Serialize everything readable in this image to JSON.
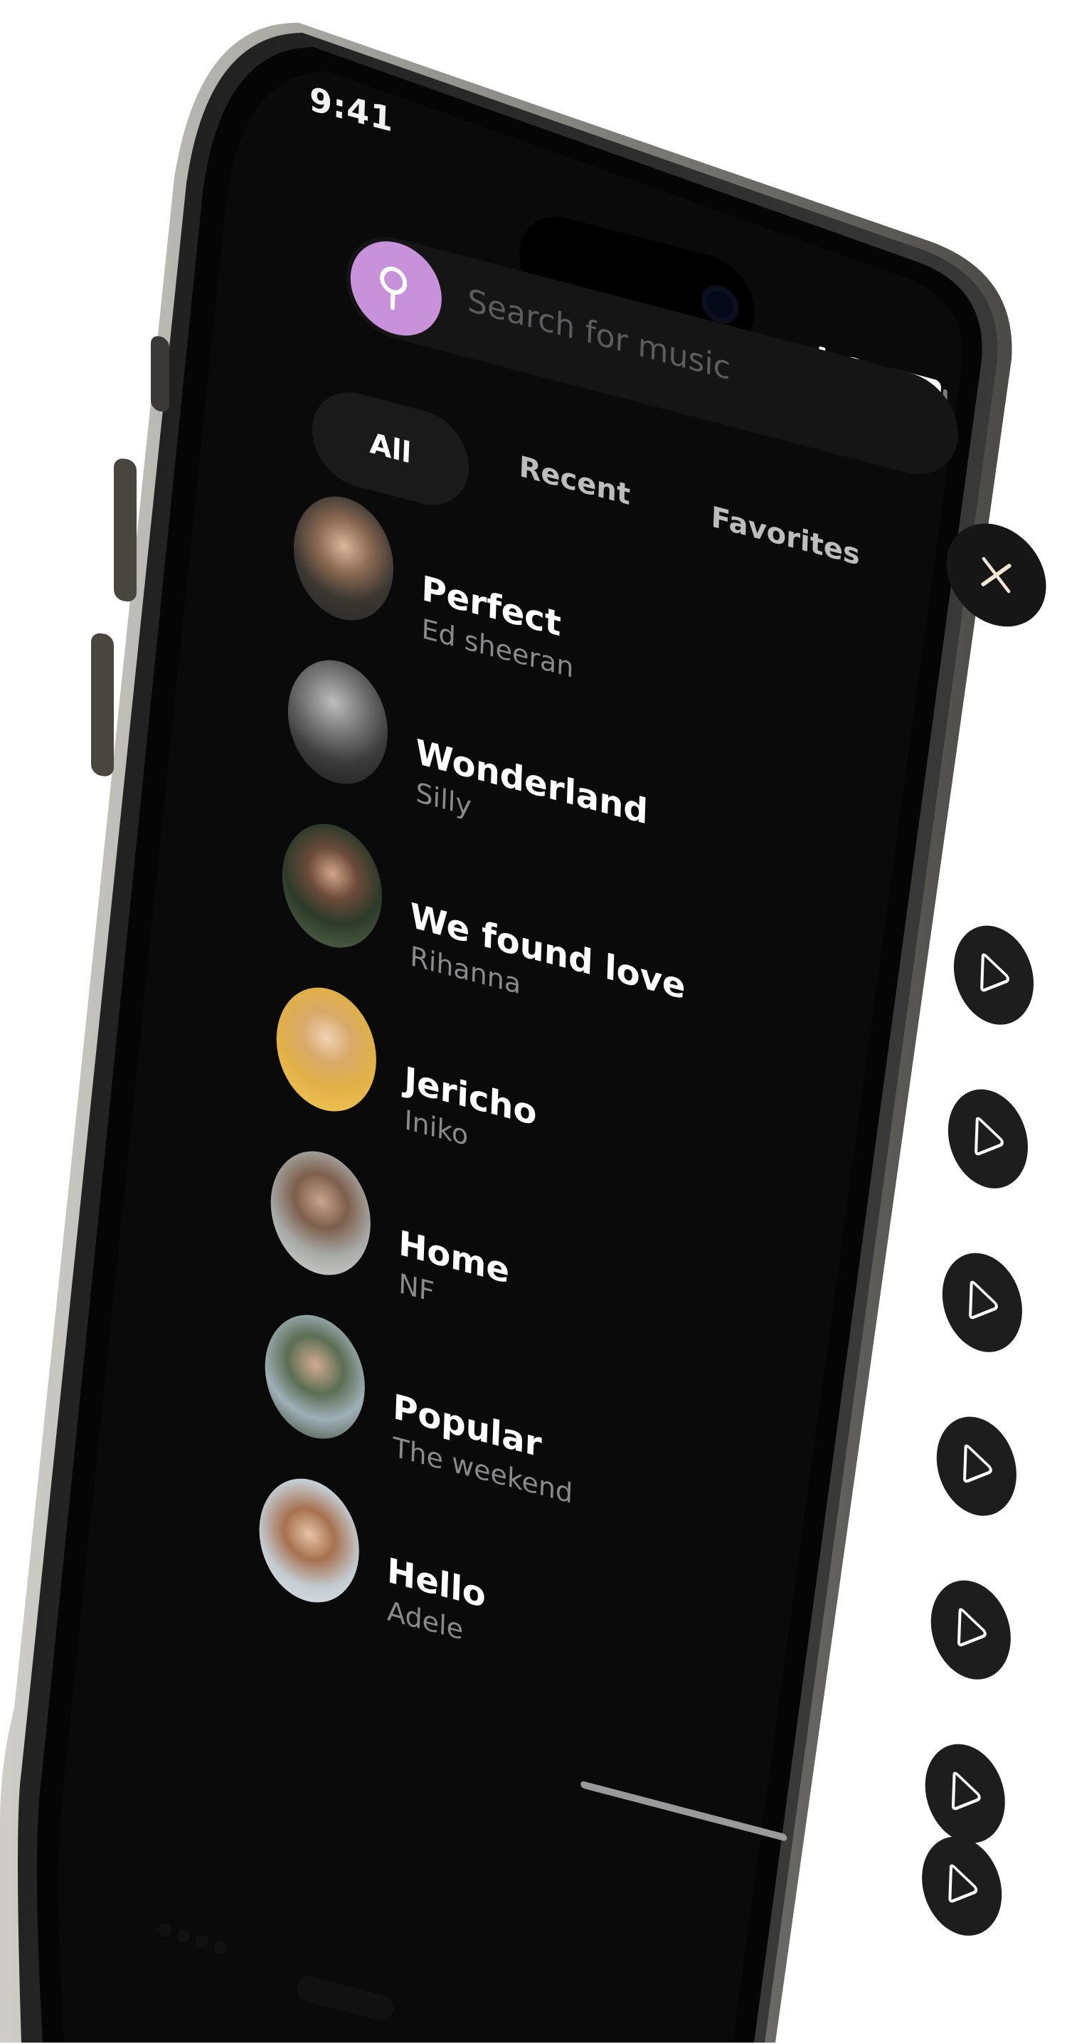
{
  "status_bar": {
    "time": "9:41"
  },
  "search": {
    "placeholder": "Search for music",
    "icon": "search-icon",
    "accent": "#c792d9"
  },
  "close_icon": "close-icon",
  "tabs": [
    {
      "label": "All",
      "selected": true
    },
    {
      "label": "Recent",
      "selected": false
    },
    {
      "label": "Favorites",
      "selected": false
    }
  ],
  "songs": [
    {
      "title": "Perfect",
      "artist": "Ed sheeran"
    },
    {
      "title": "Wonderland",
      "artist": "Silly"
    },
    {
      "title": "We found love",
      "artist": "Rihanna"
    },
    {
      "title": "Jericho",
      "artist": "Iniko"
    },
    {
      "title": "Home",
      "artist": "NF"
    },
    {
      "title": "Popular",
      "artist": "The weekend"
    },
    {
      "title": "Hello",
      "artist": "Adele"
    }
  ],
  "play_icon": "play-icon",
  "colors": {
    "background": "#0a0a0a",
    "surface": "#151516",
    "text_primary": "#ffffff",
    "text_secondary": "#8a8a8c"
  }
}
